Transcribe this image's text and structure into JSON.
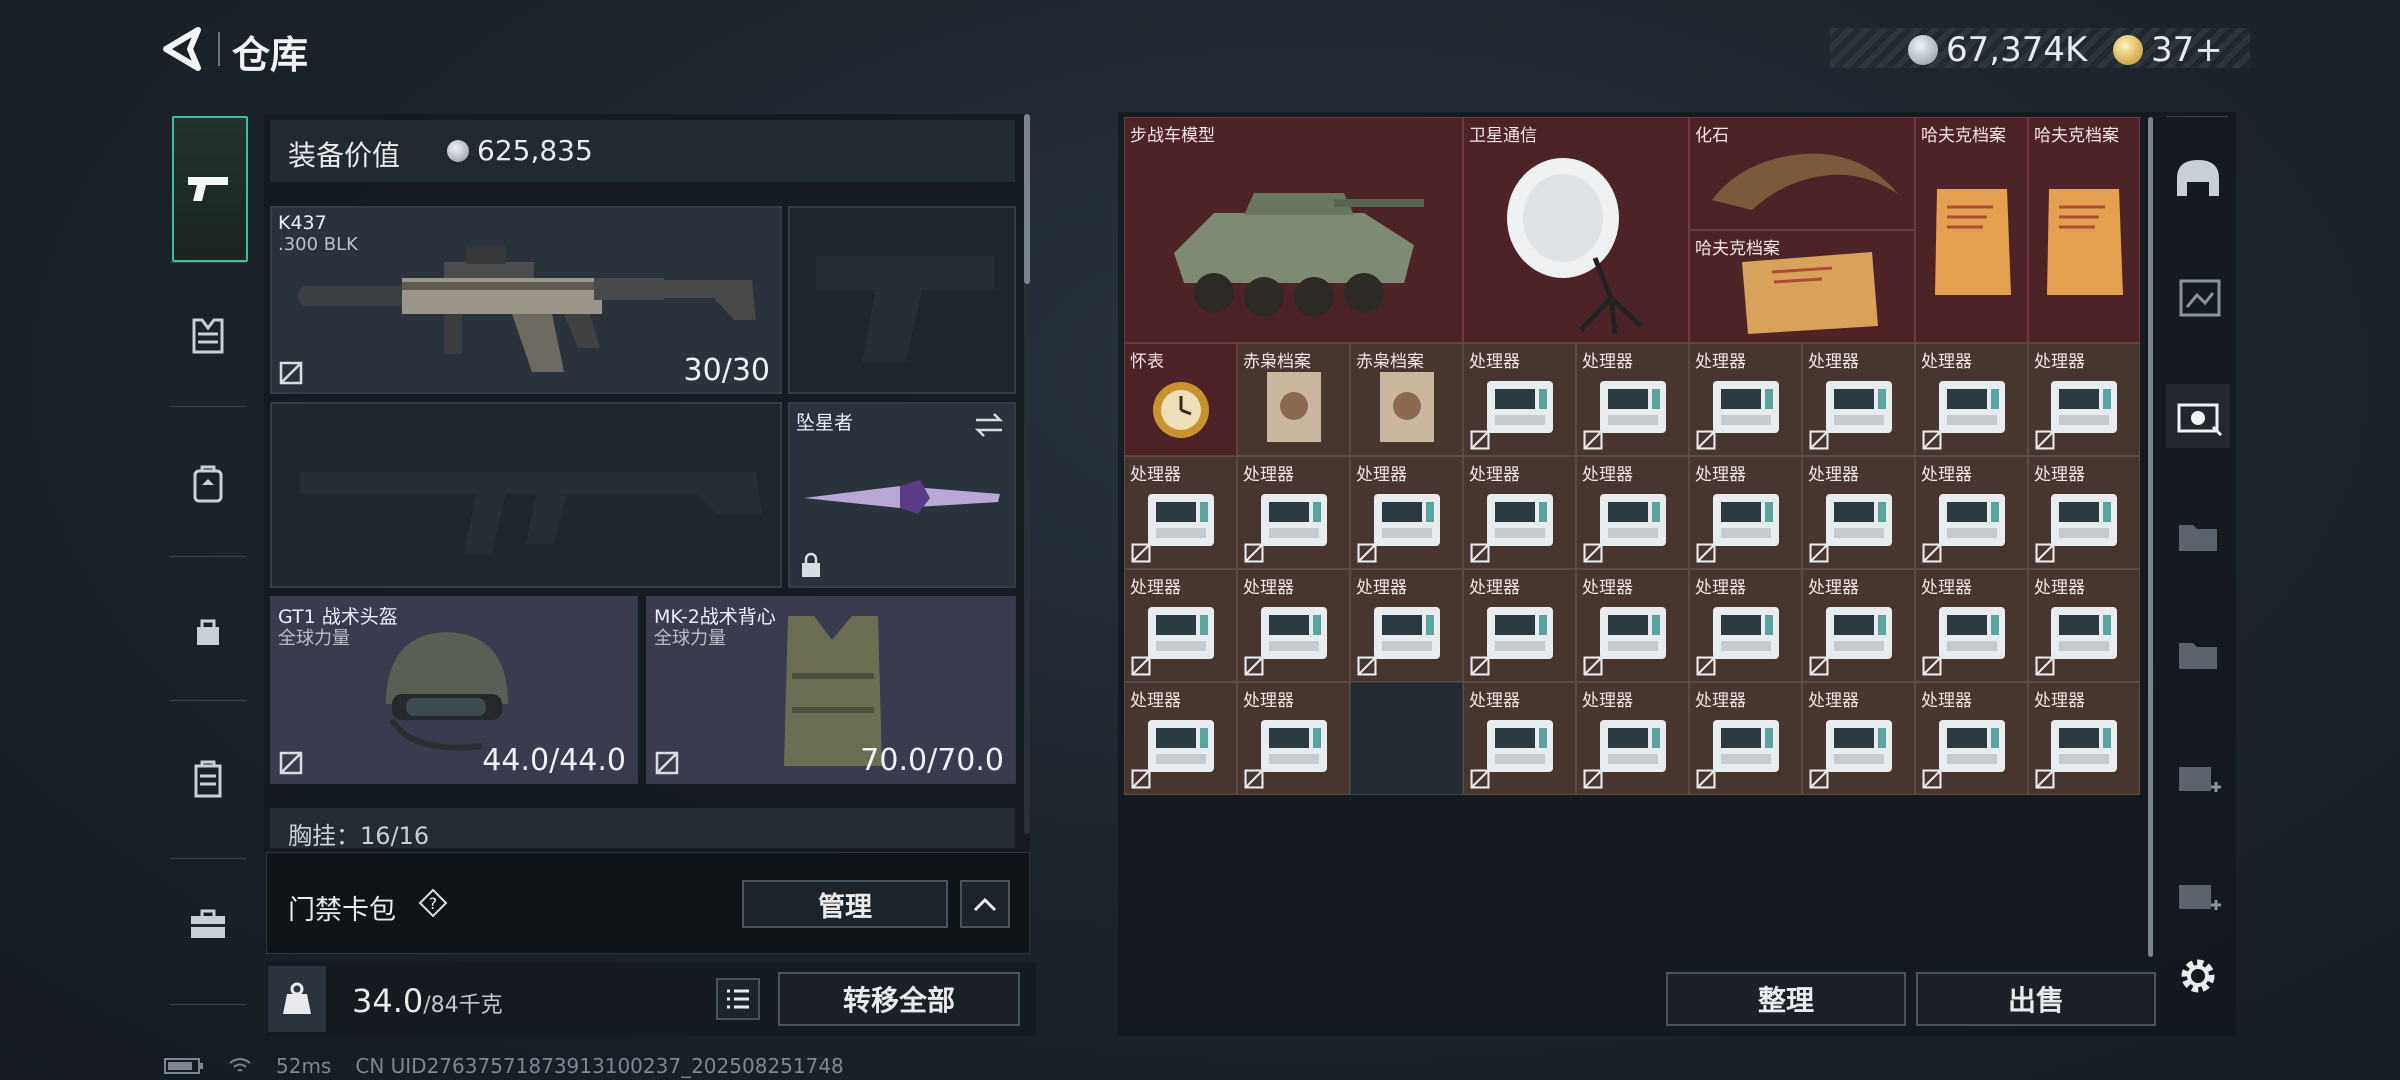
{
  "header": {
    "title": "仓库"
  },
  "currency": {
    "money": "67,374K",
    "tickets": "37+"
  },
  "sidebar": {
    "items": [
      {
        "icon": "pistol-icon",
        "active": true
      },
      {
        "icon": "vest-icon"
      },
      {
        "icon": "backpack-icon"
      },
      {
        "icon": "pouch-icon"
      },
      {
        "icon": "locker-icon"
      },
      {
        "icon": "briefcase-icon"
      }
    ]
  },
  "loadout": {
    "value_label": "装备价值",
    "value_amount": "625,835",
    "primary": {
      "name": "K437",
      "ammo": ".300 BLK",
      "count": "30/30"
    },
    "melee": {
      "name": "坠星者"
    },
    "helmet": {
      "name": "GT1 战术头盔",
      "sub": "全球力量",
      "durability": "44.0/44.0"
    },
    "armor": {
      "name": "MK-2战术背心",
      "sub": "全球力量",
      "durability": "70.0/70.0"
    },
    "chest_rig": "胸挂：16/16"
  },
  "keycard": {
    "label": "门禁卡包",
    "help": "?",
    "manage": "管理"
  },
  "weight": {
    "value": "34.0",
    "max": "/84千克"
  },
  "transfer_all": "转移全部",
  "stash": {
    "items": [
      {
        "label": "步战车模型"
      },
      {
        "label": "卫星通信"
      },
      {
        "label": "化石"
      },
      {
        "label": "哈夫克档案"
      },
      {
        "label": "哈夫克档案"
      },
      {
        "label": "哈夫克档案"
      },
      {
        "label": "怀表"
      },
      {
        "label": "赤枭档案"
      },
      {
        "label": "赤枭档案"
      }
    ],
    "processor_label": "处理器",
    "sort": "整理",
    "sell": "出售"
  },
  "status": {
    "ping": "52ms",
    "uid": "CN UID2763757187391310​0237_202508251748"
  },
  "right_tabs": [
    "helmet-tab",
    "container-2",
    "container-3",
    "container-4",
    "container-5",
    "add-container-1",
    "add-container-2",
    "settings"
  ]
}
